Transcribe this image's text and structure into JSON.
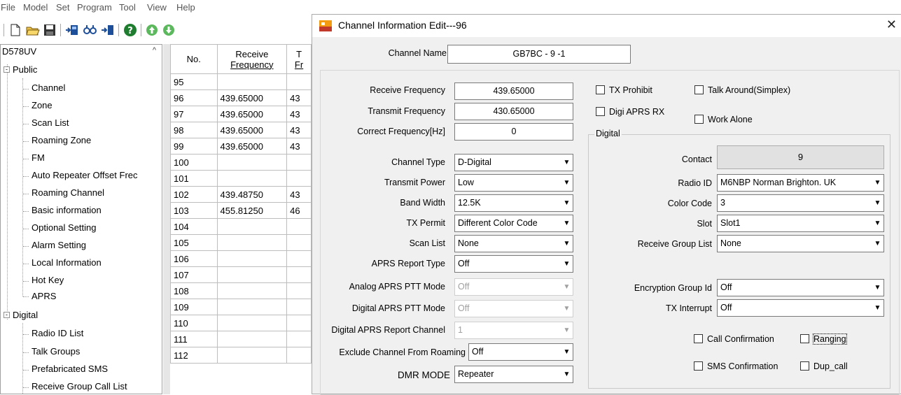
{
  "menubar": {
    "items": [
      {
        "label": "File"
      },
      {
        "label": "Model"
      },
      {
        "label": "Set"
      },
      {
        "label": "Program"
      },
      {
        "label": "Tool"
      },
      {
        "label": "View"
      },
      {
        "label": "Help"
      }
    ]
  },
  "toolbar": {
    "icons": [
      "new-file-icon",
      "open-folder-icon",
      "save-icon",
      "read-radio-icon",
      "write-radio-icon",
      "transfer-icon",
      "help-icon",
      "up-icon",
      "down-icon"
    ]
  },
  "tree": {
    "root": "D578UV",
    "groups": [
      {
        "label": "Public",
        "expander": "-",
        "items": [
          "Channel",
          "Zone",
          "Scan List",
          "Roaming Zone",
          "FM",
          "Auto Repeater Offset Frec",
          "Roaming Channel",
          "Basic information",
          "Optional Setting",
          "Alarm Setting",
          "Local Information",
          "Hot Key",
          "APRS"
        ]
      },
      {
        "label": "Digital",
        "expander": "-",
        "items": [
          "Radio ID List",
          "Talk Groups",
          "Prefabricated SMS",
          "Receive Group Call List"
        ]
      }
    ]
  },
  "grid": {
    "headers": {
      "no": "No.",
      "rx_line1": "Receive",
      "rx_line2": "Frequency",
      "tx_line1": "T",
      "tx_line2": "Fr"
    },
    "rows": [
      {
        "no": "95",
        "rx": "",
        "tx": ""
      },
      {
        "no": "96",
        "rx": "439.65000",
        "tx": "43"
      },
      {
        "no": "97",
        "rx": "439.65000",
        "tx": "43"
      },
      {
        "no": "98",
        "rx": "439.65000",
        "tx": "43"
      },
      {
        "no": "99",
        "rx": "439.65000",
        "tx": "43"
      },
      {
        "no": "100",
        "rx": "",
        "tx": ""
      },
      {
        "no": "101",
        "rx": "",
        "tx": ""
      },
      {
        "no": "102",
        "rx": "439.48750",
        "tx": "43"
      },
      {
        "no": "103",
        "rx": "455.81250",
        "tx": "46"
      },
      {
        "no": "104",
        "rx": "",
        "tx": ""
      },
      {
        "no": "105",
        "rx": "",
        "tx": ""
      },
      {
        "no": "106",
        "rx": "",
        "tx": ""
      },
      {
        "no": "107",
        "rx": "",
        "tx": ""
      },
      {
        "no": "108",
        "rx": "",
        "tx": ""
      },
      {
        "no": "109",
        "rx": "",
        "tx": ""
      },
      {
        "no": "110",
        "rx": "",
        "tx": ""
      },
      {
        "no": "111",
        "rx": "",
        "tx": ""
      },
      {
        "no": "112",
        "rx": "",
        "tx": ""
      }
    ]
  },
  "dialog": {
    "title": "Channel Information Edit---96",
    "close_glyph": "✕",
    "channel_name_label": "Channel Name",
    "channel_name_value": "GB7BC - 9 -1",
    "receive_frequency_label": "Receive Frequency",
    "receive_frequency_value": "439.65000",
    "transmit_frequency_label": "Transmit Frequency",
    "transmit_frequency_value": "430.65000",
    "correct_frequency_label": "Correct Frequency[Hz]",
    "correct_frequency_value": "0",
    "combos_left": [
      {
        "label": "Channel Type",
        "value": "D-Digital",
        "disabled": false
      },
      {
        "label": "Transmit Power",
        "value": "Low",
        "disabled": false
      },
      {
        "label": "Band Width",
        "value": "12.5K",
        "disabled": false
      },
      {
        "label": "TX Permit",
        "value": "Different Color Code",
        "disabled": false
      },
      {
        "label": "Scan List",
        "value": "None",
        "disabled": false
      },
      {
        "label": "APRS Report Type",
        "value": "Off",
        "disabled": false
      },
      {
        "label": "Analog APRS PTT Mode",
        "value": "Off",
        "disabled": true
      },
      {
        "label": "Digital APRS PTT Mode",
        "value": "Off",
        "disabled": true
      },
      {
        "label": "Digital APRS Report Channel",
        "value": "1",
        "disabled": true
      }
    ],
    "exclude_roaming_label": "Exclude Channel From Roaming",
    "exclude_roaming_value": "Off",
    "dmr_mode_label": "DMR MODE",
    "dmr_mode_value": "Repeater",
    "tx_prohibit_label": "TX Prohibit",
    "talk_around_label": "Talk Around(Simplex)",
    "digi_aprs_rx_label": "Digi APRS RX",
    "work_alone_label": "Work Alone",
    "digital_group_title": "Digital",
    "contact_label": "Contact",
    "contact_value": "9",
    "combos_right": [
      {
        "label": "Radio ID",
        "value": "M6NBP Norman Brighton. UK"
      },
      {
        "label": "Color Code",
        "value": "3"
      },
      {
        "label": "Slot",
        "value": "Slot1"
      },
      {
        "label": "Receive Group List",
        "value": "None"
      },
      {
        "label": "Encryption Group Id",
        "value": "Off"
      },
      {
        "label": "TX Interrupt",
        "value": "Off"
      }
    ],
    "call_confirmation_label": "Call Confirmation",
    "ranging_label": "Ranging",
    "sms_confirmation_label": "SMS Confirmation",
    "dup_call_label": "Dup_call",
    "dropdown_arrow": "▼"
  }
}
